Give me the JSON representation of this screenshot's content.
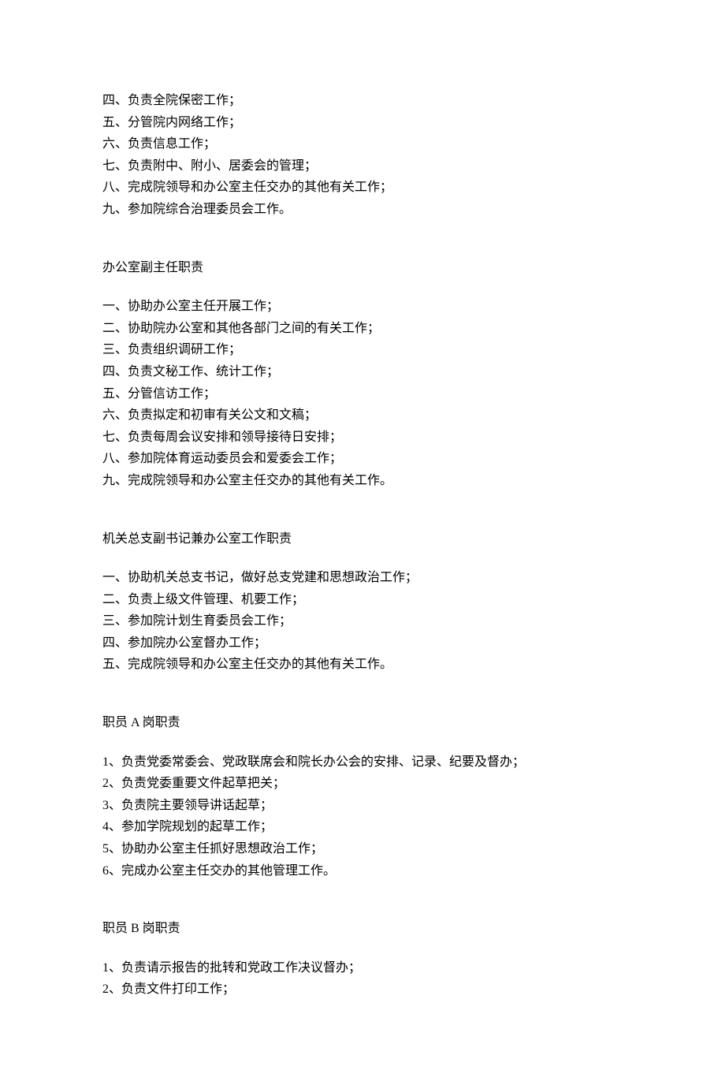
{
  "section1": {
    "items": [
      "四、负责全院保密工作；",
      "五、分管院内网络工作；",
      "六、负责信息工作；",
      "七、负责附中、附小、居委会的管理；",
      "八、完成院领导和办公室主任交办的其他有关工作；",
      "九、参加院综合治理委员会工作。"
    ]
  },
  "section2": {
    "heading": "办公室副主任职责",
    "items": [
      "一、协助办公室主任开展工作；",
      "二、协助院办公室和其他各部门之间的有关工作；",
      "三、负责组织调研工作；",
      "四、负责文秘工作、统计工作；",
      "五、分管信访工作；",
      "六、负责拟定和初审有关公文和文稿；",
      "七、负责每周会议安排和领导接待日安排；",
      "八、参加院体育运动委员会和爱委会工作；",
      "九、完成院领导和办公室主任交办的其他有关工作。"
    ]
  },
  "section3": {
    "heading": "机关总支副书记兼办公室工作职责",
    "items": [
      "一、协助机关总支书记，做好总支党建和思想政治工作；",
      "二、负责上级文件管理、机要工作；",
      "三、参加院计划生育委员会工作；",
      "四、参加院办公室督办工作；",
      "五、完成院领导和办公室主任交办的其他有关工作。"
    ]
  },
  "section4": {
    "heading": "职员 A 岗职责",
    "items": [
      "1、负责党委常委会、党政联席会和院长办公会的安排、记录、纪要及督办；",
      "2、负责党委重要文件起草把关；",
      "3、负责院主要领导讲话起草；",
      "4、参加学院规划的起草工作；",
      "5、协助办公室主任抓好思想政治工作；",
      "6、完成办公室主任交办的其他管理工作。"
    ]
  },
  "section5": {
    "heading": "职员 B 岗职责",
    "items": [
      "1、负责请示报告的批转和党政工作决议督办；",
      "2、负责文件打印工作；"
    ]
  }
}
